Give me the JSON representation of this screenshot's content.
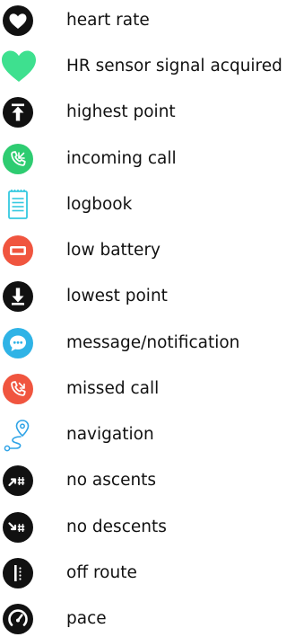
{
  "icons": [
    {
      "icon": "heart-icon",
      "label": "heart rate",
      "color": "#111111"
    },
    {
      "icon": "heart-signal-icon",
      "label": "HR sensor signal acquired",
      "color": "#3ee08f"
    },
    {
      "icon": "arrow-up-icon",
      "label": "highest point",
      "color": "#111111"
    },
    {
      "icon": "phone-incoming-icon",
      "label": "incoming call",
      "color": "#2ecc71"
    },
    {
      "icon": "logbook-icon",
      "label": "logbook",
      "color": "#35c9e0"
    },
    {
      "icon": "battery-low-icon",
      "label": "low battery",
      "color": "#f0553f"
    },
    {
      "icon": "arrow-down-icon",
      "label": "lowest point",
      "color": "#111111"
    },
    {
      "icon": "message-icon",
      "label": "message/notification",
      "color": "#2fb3e6"
    },
    {
      "icon": "phone-missed-icon",
      "label": "missed call",
      "color": "#f0553f"
    },
    {
      "icon": "navigation-icon",
      "label": "navigation",
      "color": "#2fa3e6"
    },
    {
      "icon": "no-ascent-icon",
      "label": "no ascents",
      "color": "#111111"
    },
    {
      "icon": "no-descent-icon",
      "label": "no descents",
      "color": "#111111"
    },
    {
      "icon": "off-route-icon",
      "label": "off route",
      "color": "#111111"
    },
    {
      "icon": "pace-icon",
      "label": "pace",
      "color": "#111111"
    }
  ]
}
